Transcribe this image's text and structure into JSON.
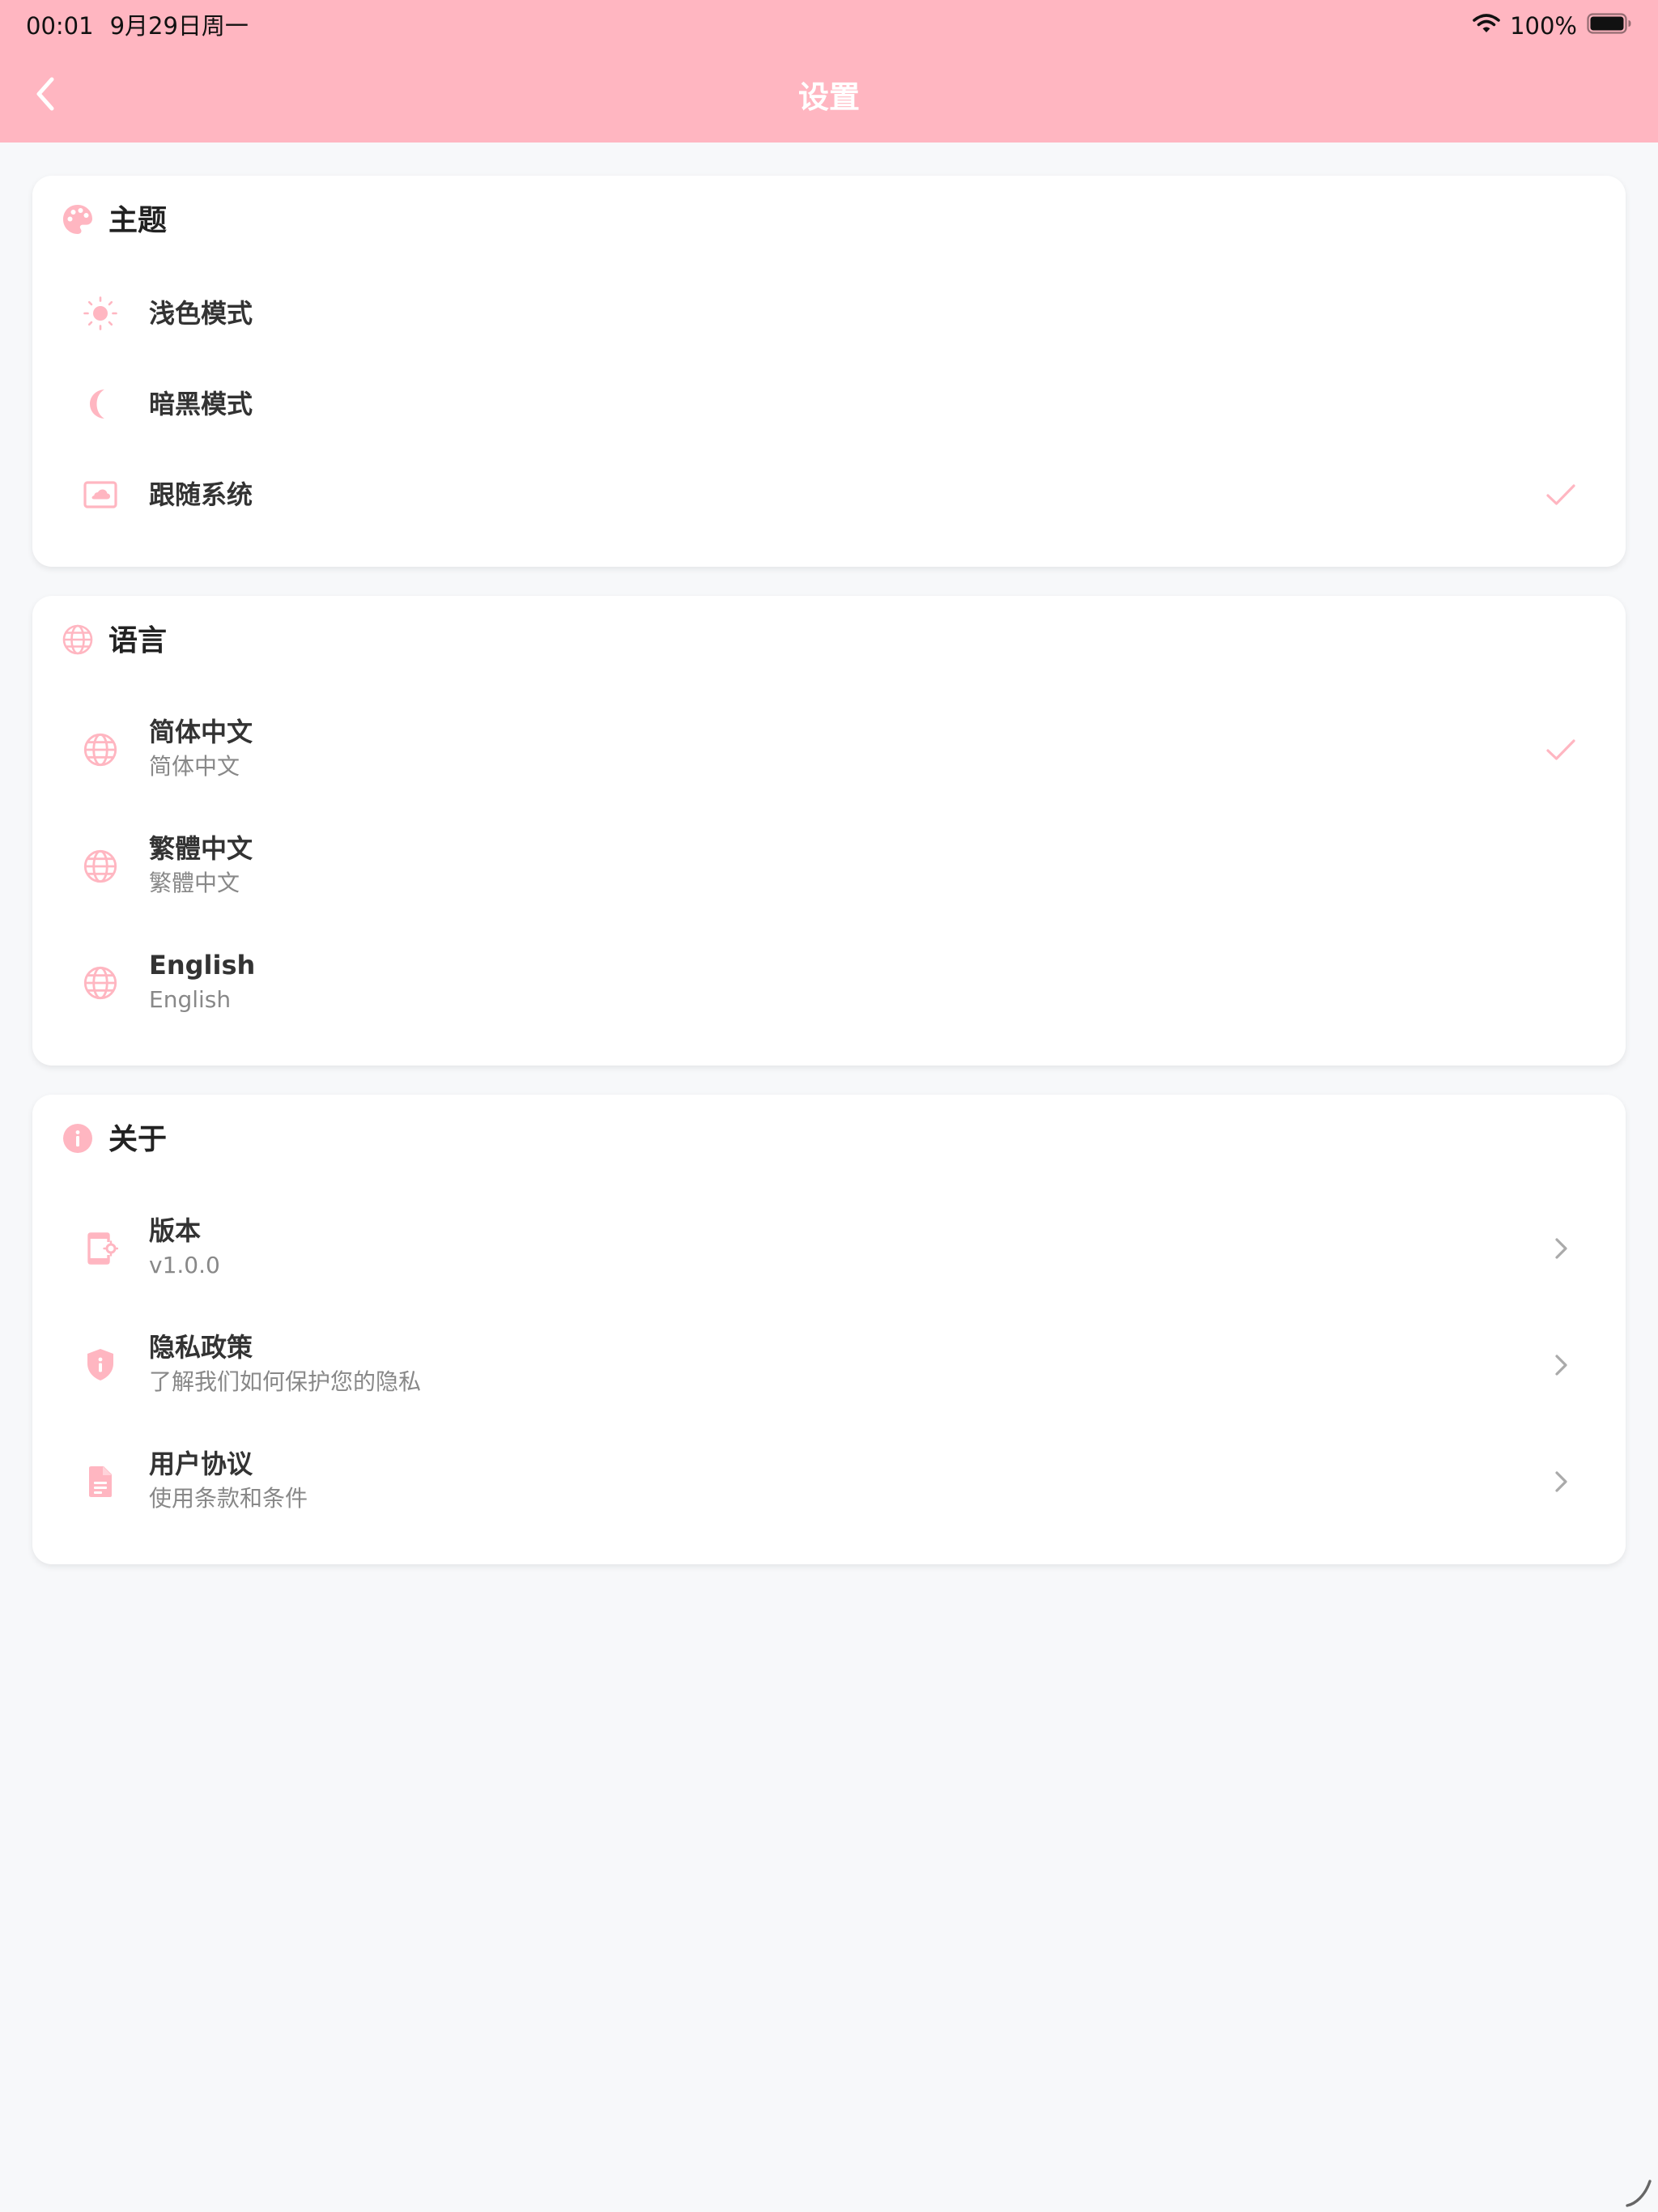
{
  "status_bar": {
    "time": "00:01",
    "date": "9月29日周一",
    "battery": "100%"
  },
  "nav": {
    "title": "设置",
    "back_icon": "chevron-left-icon"
  },
  "colors": {
    "accent": "#FFB6C1",
    "background": "#F7F8FA",
    "card": "#FFFFFF",
    "text": "#333333",
    "subtext": "#888888",
    "chevron": "#AAAAAA"
  },
  "theme": {
    "title": "主题",
    "icon": "palette-icon",
    "options": [
      {
        "label": "浅色模式",
        "icon": "sun-icon",
        "selected": false
      },
      {
        "label": "暗黑模式",
        "icon": "moon-icon",
        "selected": false
      },
      {
        "label": "跟随系统",
        "icon": "system-display-icon",
        "selected": true
      }
    ]
  },
  "language": {
    "title": "语言",
    "icon": "globe-icon",
    "options": [
      {
        "label": "简体中文",
        "sub": "简体中文",
        "icon": "globe-icon",
        "selected": true
      },
      {
        "label": "繁體中文",
        "sub": "繁體中文",
        "icon": "globe-icon",
        "selected": false
      },
      {
        "label": "English",
        "sub": "English",
        "icon": "globe-icon",
        "selected": false
      }
    ]
  },
  "about": {
    "title": "关于",
    "icon": "info-icon",
    "items": [
      {
        "label": "版本",
        "sub": "v1.0.0",
        "icon": "phone-settings-icon"
      },
      {
        "label": "隐私政策",
        "sub": "了解我们如何保护您的隐私",
        "icon": "shield-icon"
      },
      {
        "label": "用户协议",
        "sub": "使用条款和条件",
        "icon": "document-icon"
      }
    ]
  }
}
